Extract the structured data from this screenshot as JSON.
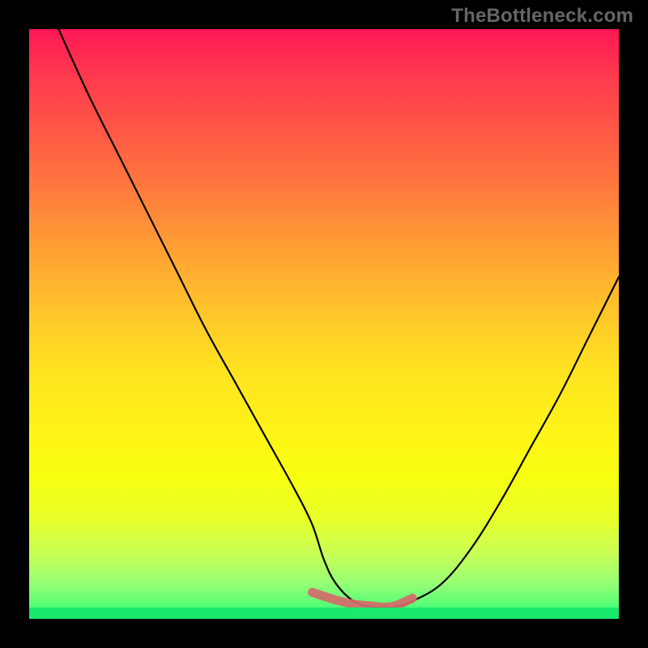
{
  "watermark": "TheBottleneck.com",
  "chart_data": {
    "type": "line",
    "title": "",
    "xlabel": "",
    "ylabel": "",
    "xlim": [
      0,
      100
    ],
    "ylim": [
      0,
      100
    ],
    "legend": false,
    "background_gradient_top": "#ff1756",
    "background_gradient_bottom": "#18e86c",
    "series": [
      {
        "name": "bottleneck-curve",
        "color": "#000000",
        "x": [
          5,
          10,
          15,
          20,
          25,
          30,
          35,
          40,
          45,
          48,
          50,
          52,
          55,
          58,
          60,
          62,
          65,
          70,
          75,
          80,
          85,
          90,
          95,
          100
        ],
        "values": [
          100,
          89,
          79,
          69,
          59,
          49,
          40,
          31,
          22,
          16,
          10,
          6,
          3,
          2,
          2,
          2,
          3,
          6,
          12,
          20,
          29,
          38,
          48,
          58
        ]
      },
      {
        "name": "optimal-band",
        "color": "#d56a6a",
        "x": [
          48,
          52,
          55,
          58,
          60,
          62,
          65
        ],
        "values": [
          4.5,
          3.2,
          2.5,
          2.2,
          2.0,
          2.2,
          3.5
        ]
      }
    ],
    "annotations": []
  }
}
